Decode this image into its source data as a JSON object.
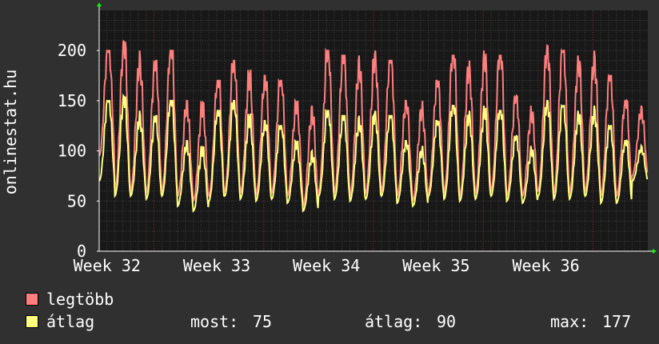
{
  "chart_data": {
    "type": "line",
    "title": "",
    "xlabel": "",
    "ylabel": "onlinestat.hu",
    "ylim": [
      0,
      240
    ],
    "yticks": [
      0,
      50,
      100,
      150,
      200
    ],
    "xlim": [
      0,
      35
    ],
    "x_unit": "days",
    "xticks": [
      {
        "label": "Week 32",
        "value": 0.5
      },
      {
        "label": "Week 33",
        "value": 7.5
      },
      {
        "label": "Week 34",
        "value": 14.5
      },
      {
        "label": "Week 35",
        "value": 21.5
      },
      {
        "label": "Week 36",
        "value": 28.5
      }
    ],
    "series": [
      {
        "name": "legtöbb",
        "color": "#ff7f7f",
        "daily_peaks": [
          200,
          210,
          200,
          190,
          200,
          150,
          150,
          170,
          190,
          185,
          175,
          170,
          150,
          145,
          200,
          195,
          195,
          200,
          190,
          150,
          150,
          170,
          195,
          190,
          200,
          195,
          155,
          145,
          205,
          200,
          195,
          200,
          175,
          150,
          145
        ],
        "daily_lows": [
          95,
          60,
          60,
          58,
          60,
          55,
          50,
          55,
          60,
          58,
          56,
          58,
          55,
          45,
          60,
          58,
          55,
          58,
          60,
          55,
          50,
          60,
          58,
          55,
          58,
          60,
          55,
          55,
          60,
          58,
          58,
          60,
          55,
          55,
          75
        ]
      },
      {
        "name": "átlag",
        "color": "#ffff80",
        "daily_peaks": [
          150,
          155,
          140,
          135,
          150,
          110,
          105,
          140,
          150,
          140,
          130,
          125,
          110,
          100,
          140,
          135,
          135,
          140,
          135,
          110,
          105,
          130,
          145,
          140,
          145,
          140,
          115,
          105,
          150,
          145,
          140,
          145,
          125,
          110,
          105
        ],
        "daily_lows": [
          70,
          55,
          55,
          52,
          55,
          45,
          40,
          50,
          55,
          52,
          50,
          52,
          48,
          40,
          55,
          52,
          50,
          52,
          55,
          48,
          45,
          55,
          52,
          50,
          52,
          55,
          50,
          48,
          55,
          52,
          52,
          55,
          48,
          48,
          70
        ]
      }
    ],
    "grid": true,
    "legend_placement": "bottom-left"
  },
  "legend": {
    "max_label": "legtöbb",
    "avg_label": "átlag",
    "now_label": "most:",
    "now_value": "75",
    "avg_stat_label": "átlag:",
    "avg_stat_value": "90",
    "max_stat_label": "max:",
    "max_stat_value": "177"
  },
  "colors": {
    "background": "#303030",
    "plot_background": "#181818",
    "grid_minor": "#404040",
    "grid_week": "#7a3030",
    "axis": "#ffffff",
    "arrow": "#00ff00"
  }
}
